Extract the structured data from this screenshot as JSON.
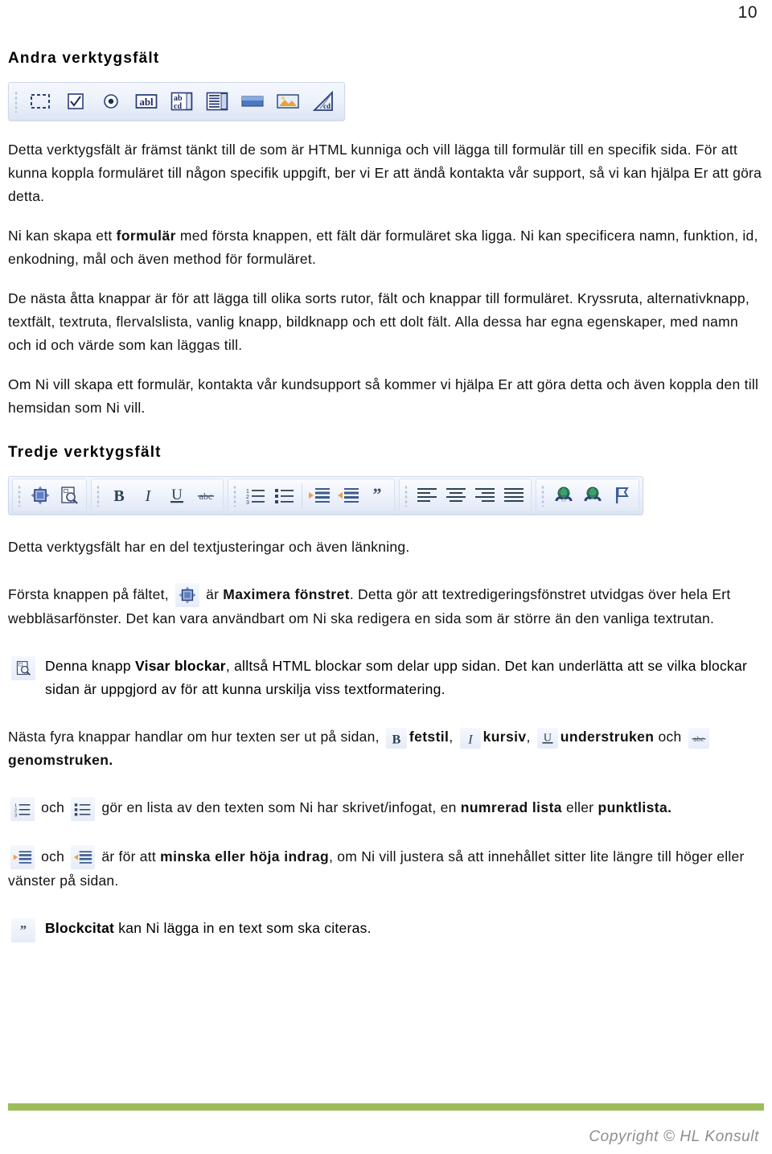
{
  "page": {
    "number": "10"
  },
  "headings": {
    "section1": "Andra verktygsfält",
    "section2": "Tredje verktygsfält"
  },
  "toolbar1": {
    "name": "andra-verktygsfalt",
    "buttons": [
      {
        "icon": "form-region-icon",
        "label": "Formulär"
      },
      {
        "icon": "checkbox-icon",
        "label": "Kryssruta"
      },
      {
        "icon": "radio-button-icon",
        "label": "Alternativknapp"
      },
      {
        "icon": "text-field-icon",
        "label": "Textfält"
      },
      {
        "icon": "textarea-icon",
        "label": "Textruta"
      },
      {
        "icon": "select-list-icon",
        "label": "Flervalslista"
      },
      {
        "icon": "button-icon",
        "label": "Vanlig knapp"
      },
      {
        "icon": "image-button-icon",
        "label": "Bildknapp"
      },
      {
        "icon": "hidden-field-icon",
        "label": "Dolt fält"
      }
    ]
  },
  "toolbar2": {
    "name": "tredje-verktygsfalt",
    "groups": [
      {
        "buttons": [
          {
            "icon": "maximize-window-icon",
            "label": "Maximera fönstret"
          },
          {
            "icon": "show-blocks-icon",
            "label": "Visar blockar"
          }
        ]
      },
      {
        "buttons": [
          {
            "icon": "bold-icon",
            "label": "Fetstil"
          },
          {
            "icon": "italic-icon",
            "label": "Kursiv"
          },
          {
            "icon": "underline-icon",
            "label": "Understruken"
          },
          {
            "icon": "strikethrough-icon",
            "label": "Genomstruken"
          }
        ]
      },
      {
        "buttons": [
          {
            "icon": "numbered-list-icon",
            "label": "Numrerad lista"
          },
          {
            "icon": "bulleted-list-icon",
            "label": "Punktlista"
          },
          {
            "icon": "decrease-indent-icon",
            "label": "Minska indrag"
          },
          {
            "icon": "increase-indent-icon",
            "label": "Höja indrag"
          },
          {
            "icon": "blockquote-icon",
            "label": "Blockcitat"
          }
        ]
      },
      {
        "buttons": [
          {
            "icon": "align-left-icon",
            "label": "Vänsterjustera"
          },
          {
            "icon": "align-center-icon",
            "label": "Centrera"
          },
          {
            "icon": "align-right-icon",
            "label": "Högerjustera"
          },
          {
            "icon": "align-justify-icon",
            "label": "Marginaljustera"
          }
        ]
      },
      {
        "buttons": [
          {
            "icon": "insert-link-icon",
            "label": "Infoga länk"
          },
          {
            "icon": "remove-link-icon",
            "label": "Ta bort länk"
          },
          {
            "icon": "anchor-flag-icon",
            "label": "Ankare"
          }
        ]
      }
    ]
  },
  "paragraphs": {
    "p1": "Detta verktygsfält är främst tänkt till de som är HTML kunniga och vill lägga till formulär till en specifik sida. För att kunna koppla formuläret till någon specifik uppgift, ber vi Er att ändå kontakta vår support, så vi kan hjälpa Er att göra detta.",
    "p2_a": "Ni kan skapa ett ",
    "p2_b": "formulär",
    "p2_c": " med första knappen, ett fält där formuläret ska ligga. Ni kan specificera namn, funktion, id, enkodning, mål och även method för formuläret.",
    "p3": "De nästa åtta knappar är för att lägga till olika sorts rutor, fält och knappar till formuläret. Kryssruta, alternativknapp, textfält, textruta, flervalslista, vanlig knapp, bildknapp och ett dolt fält. Alla dessa har egna egenskaper, med namn och id och värde som kan läggas till.",
    "p4": "Om Ni vill skapa ett formulär, kontakta vår kundsupport så kommer vi hjälpa Er att göra detta och även koppla den till hemsidan som Ni vill.",
    "p5": "Detta verktygsfält har en del textjusteringar och även länkning.",
    "p6_a": "Första knappen på fältet, ",
    "p6_b": " är ",
    "p6_c": "Maximera fönstret",
    "p6_d": ". Detta gör att textredigeringsfönstret utvidgas över hela Ert webbläsarfönster. Det kan vara användbart om Ni ska redigera en sida som är större än den vanliga textrutan.",
    "p7_a": "Denna knapp ",
    "p7_b": "Visar blockar",
    "p7_c": ", alltså HTML blockar som delar upp sidan. Det kan underlätta att se vilka blockar sidan är uppgjord av för att kunna urskilja viss textformatering.",
    "p8_a": "Nästa fyra knappar handlar om hur texten ser ut på sidan, ",
    "p8_b": "fetstil",
    "p8_c": ", ",
    "p8_d": "kursiv",
    "p8_e": ", ",
    "p8_f": "understruken",
    "p8_g": " och ",
    "p8_h": "genomstruken.",
    "p9_a": "och",
    "p9_b": "gör en lista av den texten som Ni har skrivet/infogat, en ",
    "p9_c": "numrerad lista",
    "p9_d": " eller ",
    "p9_e": "punktlista.",
    "p10_a": "och",
    "p10_b": "är för att ",
    "p10_c": "minska eller höja indrag",
    "p10_d": ", om Ni vill justera så att innehållet sitter lite längre till höger eller vänster på sidan.",
    "p11_a": "Blockcitat",
    "p11_b": " kan Ni lägga in en text som ska citeras."
  },
  "footer": {
    "copyright": "Copyright © HL Konsult",
    "bar_color": "#9cbd5a"
  }
}
